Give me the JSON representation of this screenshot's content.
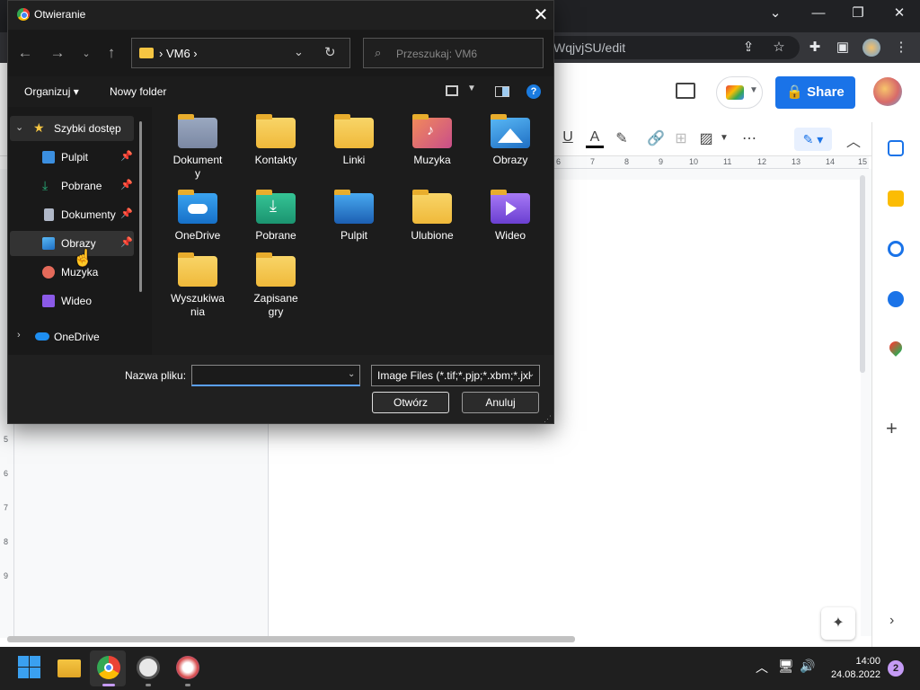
{
  "browser": {
    "url_fragment": "WqjvjSU/edit",
    "share_label": "Share"
  },
  "ruler_ticks": [
    "6",
    "7",
    "8",
    "9",
    "10",
    "11",
    "12",
    "13",
    "14",
    "15"
  ],
  "left_ruler_ticks": [
    "5",
    "6",
    "7",
    "8",
    "9"
  ],
  "dialog": {
    "title": "Otwieranie",
    "address_path": "VM6",
    "search_placeholder": "Przeszukaj: VM6",
    "organize_label": "Organizuj",
    "new_folder_label": "Nowy folder",
    "nav": {
      "quick_access": "Szybki dostęp",
      "items": [
        {
          "label": "Pulpit",
          "icon": "desktop-icon",
          "color": "#3b8fe0",
          "pinned": true
        },
        {
          "label": "Pobrane",
          "icon": "download-icon",
          "color": "#27b07a",
          "pinned": true
        },
        {
          "label": "Dokumenty",
          "icon": "documents-icon",
          "color": "#b0b8c8",
          "pinned": true
        },
        {
          "label": "Obrazy",
          "icon": "pictures-icon",
          "color": "#3aa0e8",
          "pinned": true
        },
        {
          "label": "Muzyka",
          "icon": "music-icon",
          "color": "#e46a5a",
          "pinned": false
        },
        {
          "label": "Wideo",
          "icon": "video-icon",
          "color": "#8b5ae8",
          "pinned": false
        }
      ],
      "onedrive": "OneDrive"
    },
    "tiles": [
      {
        "label": "Dokument\ny",
        "icon": "documents-folder-icon"
      },
      {
        "label": "Kontakty",
        "icon": "folder-icon"
      },
      {
        "label": "Linki",
        "icon": "folder-icon"
      },
      {
        "label": "Muzyka",
        "icon": "music-folder-icon"
      },
      {
        "label": "Obrazy",
        "icon": "pictures-folder-icon"
      },
      {
        "label": "OneDrive",
        "icon": "onedrive-folder-icon"
      },
      {
        "label": "Pobrane",
        "icon": "downloads-folder-icon"
      },
      {
        "label": "Pulpit",
        "icon": "desktop-folder-icon"
      },
      {
        "label": "Ulubione",
        "icon": "folder-icon"
      },
      {
        "label": "Wideo",
        "icon": "video-folder-icon"
      },
      {
        "label": "Wyszukiwa\nnia",
        "icon": "folder-icon"
      },
      {
        "label": "Zapisane\ngry",
        "icon": "folder-icon"
      }
    ],
    "filename_label": "Nazwa pliku:",
    "filename_value": "",
    "filter_value": "Image Files (*.tif;*.pjp;*.xbm;*.jxl",
    "open_label": "Otwórz",
    "cancel_label": "Anuluj"
  },
  "taskbar": {
    "time": "14:00",
    "date": "24.08.2022",
    "notification_count": "2"
  },
  "colors": {
    "accent": "#1a73e8",
    "dialog_bg": "#1c1c1c",
    "folder": "#f5c542"
  }
}
